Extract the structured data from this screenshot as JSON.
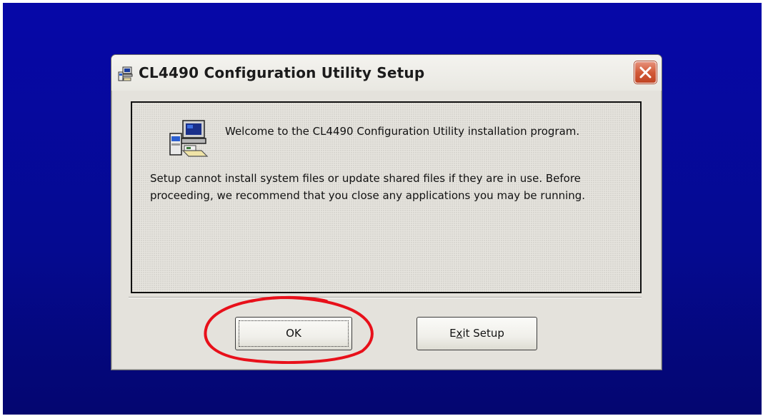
{
  "dialog": {
    "title": "CL4490 Configuration Utility Setup",
    "close_icon": "close-icon"
  },
  "content": {
    "welcome": "Welcome to the CL4490 Configuration Utility installation program.",
    "body": "Setup cannot install system files or update shared files if they are in use. Before proceeding, we recommend that you close any applications you may be running.",
    "icon": "setup-computer-icon"
  },
  "buttons": {
    "ok_label": "OK",
    "exit_label_prefix": "E",
    "exit_label_accel": "x",
    "exit_label_suffix": "it Setup"
  },
  "annotation": {
    "color": "#e8101a",
    "shape": "hand-drawn circle around OK button"
  },
  "colors": {
    "desktop": "#0608a8",
    "dialog_bg": "#e4e2dc",
    "close_button": "#d25a38"
  }
}
